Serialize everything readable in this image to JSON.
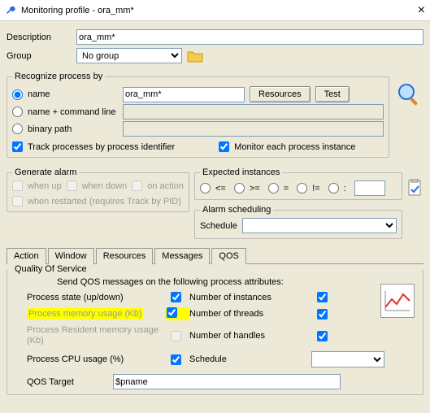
{
  "window": {
    "title": "Monitoring profile - ora_mm*"
  },
  "description": {
    "label": "Description",
    "value": "ora_mm*"
  },
  "group": {
    "label": "Group",
    "value": "No group"
  },
  "recognize": {
    "legend": "Recognize process by",
    "name_label": "name",
    "name_value": "ora_mm*",
    "name_cmd_label": "name + command line",
    "binary_label": "binary path",
    "resources_btn": "Resources",
    "test_btn": "Test",
    "track_by_pid": "Track processes by process identifier",
    "monitor_each": "Monitor each process instance"
  },
  "generate_alarm": {
    "legend": "Generate alarm",
    "when_up": "when up",
    "when_down": "when down",
    "on_action": "on action",
    "when_restarted": "when restarted (requires Track by PID)"
  },
  "expected": {
    "legend": "Expected instances",
    "value": ""
  },
  "alarm_sched": {
    "legend": "Alarm scheduling",
    "label": "Schedule",
    "value": ""
  },
  "tabs": [
    "Action",
    "Window",
    "Resources",
    "Messages",
    "QOS"
  ],
  "qos": {
    "legend": "Quality Of Service",
    "intro": "Send QOS messages on the following process attributes:",
    "rows": {
      "state": "Process state (up/down)",
      "instances": "Number of instances",
      "mem": "Process memory usage (Kb)",
      "threads": "Number of threads",
      "resmem": "Process Resident memory usage (Kb)",
      "handles": "Number of handles",
      "cpu": "Process CPU usage (%)",
      "schedule": "Schedule"
    },
    "target_label": "QOS Target",
    "target_value": "$pname"
  }
}
